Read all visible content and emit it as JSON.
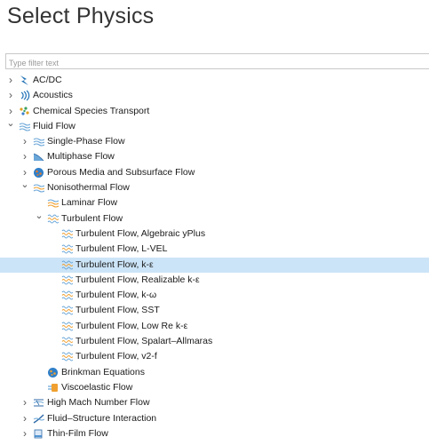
{
  "header": {
    "title": "Select Physics"
  },
  "filter": {
    "placeholder": "Type filter text",
    "value": ""
  },
  "colors": {
    "selection": "#cce4f7",
    "flow_icon_blue": "#6aa6d8",
    "flow_icon_orange": "#f0a030"
  },
  "tree": {
    "items": [
      {
        "label": "AC/DC",
        "depth": 0,
        "toggle": "collapsed",
        "icon": "acdc-icon",
        "selected": false
      },
      {
        "label": "Acoustics",
        "depth": 0,
        "toggle": "collapsed",
        "icon": "acoustics-icon",
        "selected": false
      },
      {
        "label": "Chemical Species Transport",
        "depth": 0,
        "toggle": "collapsed",
        "icon": "chemical-species-icon",
        "selected": false
      },
      {
        "label": "Fluid Flow",
        "depth": 0,
        "toggle": "expanded",
        "icon": "fluid-flow-icon",
        "selected": false
      },
      {
        "label": "Single-Phase Flow",
        "depth": 1,
        "toggle": "collapsed",
        "icon": "single-phase-flow-icon",
        "selected": false
      },
      {
        "label": "Multiphase Flow",
        "depth": 1,
        "toggle": "collapsed",
        "icon": "multiphase-flow-icon",
        "selected": false
      },
      {
        "label": "Porous Media and Subsurface Flow",
        "depth": 1,
        "toggle": "collapsed",
        "icon": "porous-media-icon",
        "selected": false
      },
      {
        "label": "Nonisothermal Flow",
        "depth": 1,
        "toggle": "expanded",
        "icon": "nonisothermal-flow-icon",
        "selected": false
      },
      {
        "label": "Laminar Flow",
        "depth": 2,
        "toggle": "none",
        "icon": "laminar-flow-icon",
        "selected": false
      },
      {
        "label": "Turbulent Flow",
        "depth": 2,
        "toggle": "expanded",
        "icon": "turbulent-flow-icon",
        "selected": false
      },
      {
        "label": "Turbulent Flow, Algebraic yPlus",
        "depth": 3,
        "toggle": "none",
        "icon": "turbulent-flow-icon",
        "selected": false
      },
      {
        "label": "Turbulent Flow, L-VEL",
        "depth": 3,
        "toggle": "none",
        "icon": "turbulent-flow-icon",
        "selected": false
      },
      {
        "label": "Turbulent Flow, k-ε",
        "depth": 3,
        "toggle": "none",
        "icon": "turbulent-flow-icon",
        "selected": true
      },
      {
        "label": "Turbulent Flow, Realizable k-ε",
        "depth": 3,
        "toggle": "none",
        "icon": "turbulent-flow-icon",
        "selected": false
      },
      {
        "label": "Turbulent Flow, k-ω",
        "depth": 3,
        "toggle": "none",
        "icon": "turbulent-flow-icon",
        "selected": false
      },
      {
        "label": "Turbulent Flow, SST",
        "depth": 3,
        "toggle": "none",
        "icon": "turbulent-flow-icon",
        "selected": false
      },
      {
        "label": "Turbulent Flow, Low Re k-ε",
        "depth": 3,
        "toggle": "none",
        "icon": "turbulent-flow-icon",
        "selected": false
      },
      {
        "label": "Turbulent Flow, Spalart–Allmaras",
        "depth": 3,
        "toggle": "none",
        "icon": "turbulent-flow-icon",
        "selected": false
      },
      {
        "label": "Turbulent Flow, v2-f",
        "depth": 3,
        "toggle": "none",
        "icon": "turbulent-flow-icon",
        "selected": false
      },
      {
        "label": "Brinkman Equations",
        "depth": 2,
        "toggle": "none",
        "icon": "brinkman-equations-icon",
        "selected": false
      },
      {
        "label": "Viscoelastic Flow",
        "depth": 2,
        "toggle": "none",
        "icon": "viscoelastic-flow-icon",
        "selected": false
      },
      {
        "label": "High Mach Number Flow",
        "depth": 1,
        "toggle": "collapsed",
        "icon": "high-mach-flow-icon",
        "selected": false
      },
      {
        "label": "Fluid–Structure Interaction",
        "depth": 1,
        "toggle": "collapsed",
        "icon": "fluid-structure-icon",
        "selected": false
      },
      {
        "label": "Thin-Film Flow",
        "depth": 1,
        "toggle": "collapsed",
        "icon": "thin-film-flow-icon",
        "selected": false
      }
    ]
  }
}
